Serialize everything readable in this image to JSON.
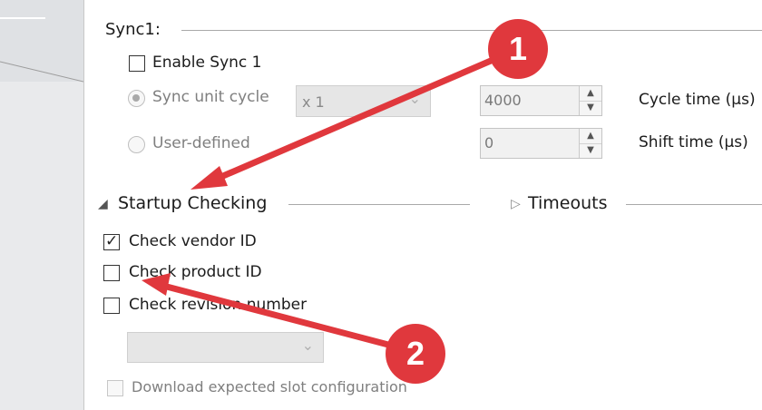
{
  "sync1": {
    "title": "Sync1:",
    "enable_label": "Enable Sync 1",
    "sync_unit_cycle_label": "Sync unit cycle",
    "user_defined_label": "User-defined",
    "multiplier_value": "x 1",
    "cycle_value": "4000",
    "shift_value": "0",
    "cycle_time_label": "Cycle time (µs)",
    "shift_time_label": "Shift time (µs)"
  },
  "startup": {
    "title": "Startup Checking",
    "check_vendor_label": "Check vendor ID",
    "check_vendor_checked": true,
    "check_product_label": "Check product ID",
    "check_product_checked": false,
    "check_revision_label": "Check revision number",
    "check_revision_checked": false,
    "revision_combo_value": "",
    "download_slot_label": "Download expected slot configuration"
  },
  "timeouts": {
    "title": "Timeouts"
  },
  "annotations": {
    "badge1": "1",
    "badge2": "2"
  },
  "colors": {
    "annotation_red": "#e0383d"
  }
}
